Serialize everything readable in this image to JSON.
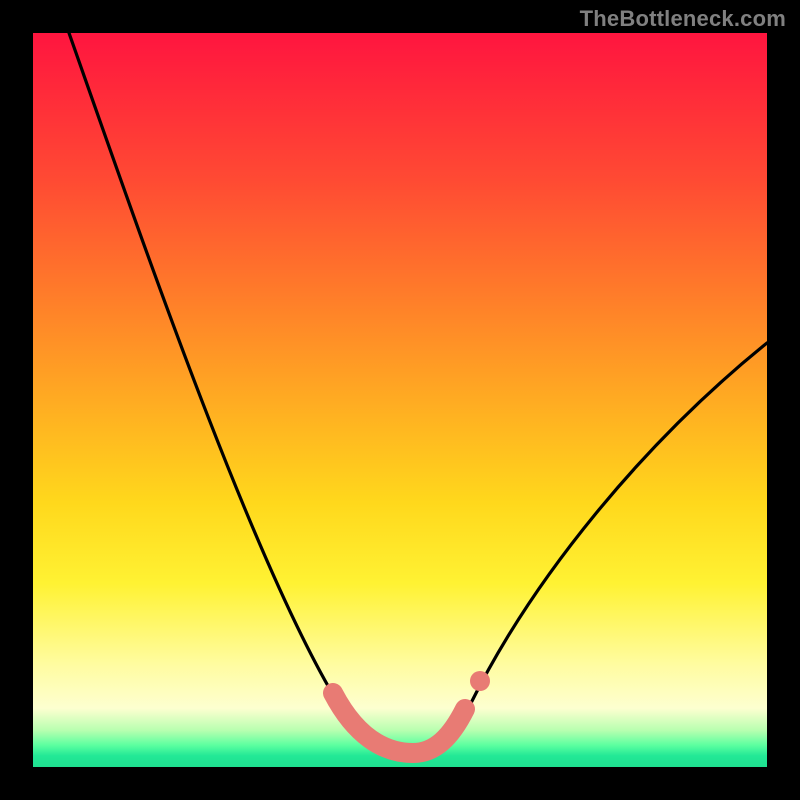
{
  "watermark": "TheBottleneck.com",
  "chart_data": {
    "type": "line",
    "title": "",
    "xlabel": "",
    "ylabel": "",
    "xlim": [
      0,
      100
    ],
    "ylim": [
      0,
      100
    ],
    "grid": false,
    "series": [
      {
        "name": "curve",
        "x": [
          5,
          9,
          13,
          17,
          21,
          25,
          29,
          33,
          37,
          41,
          44,
          47,
          50,
          53,
          56,
          60,
          65,
          70,
          75,
          80,
          85,
          90,
          95,
          100
        ],
        "y": [
          100,
          90,
          80,
          70,
          60,
          50,
          41,
          33,
          25,
          17,
          11,
          6,
          3,
          2,
          3,
          6,
          12,
          20,
          28,
          36,
          43,
          49,
          54,
          58
        ]
      }
    ],
    "markers": [
      {
        "name": "left-dot",
        "x": 42,
        "y": 9
      },
      {
        "name": "flat-l1",
        "x": 46,
        "y": 3
      },
      {
        "name": "flat-l2",
        "x": 50,
        "y": 2
      },
      {
        "name": "flat-r1",
        "x": 54,
        "y": 2.5
      },
      {
        "name": "right-dot",
        "x": 58,
        "y": 6
      },
      {
        "name": "iso-dot",
        "x": 61,
        "y": 10
      }
    ],
    "gradient_stops": [
      {
        "pos": 0,
        "color": "#ff153f"
      },
      {
        "pos": 0.5,
        "color": "#ffab22"
      },
      {
        "pos": 0.86,
        "color": "#fffca0"
      },
      {
        "pos": 0.97,
        "color": "#5dffa0"
      },
      {
        "pos": 1.0,
        "color": "#1fe090"
      }
    ]
  }
}
